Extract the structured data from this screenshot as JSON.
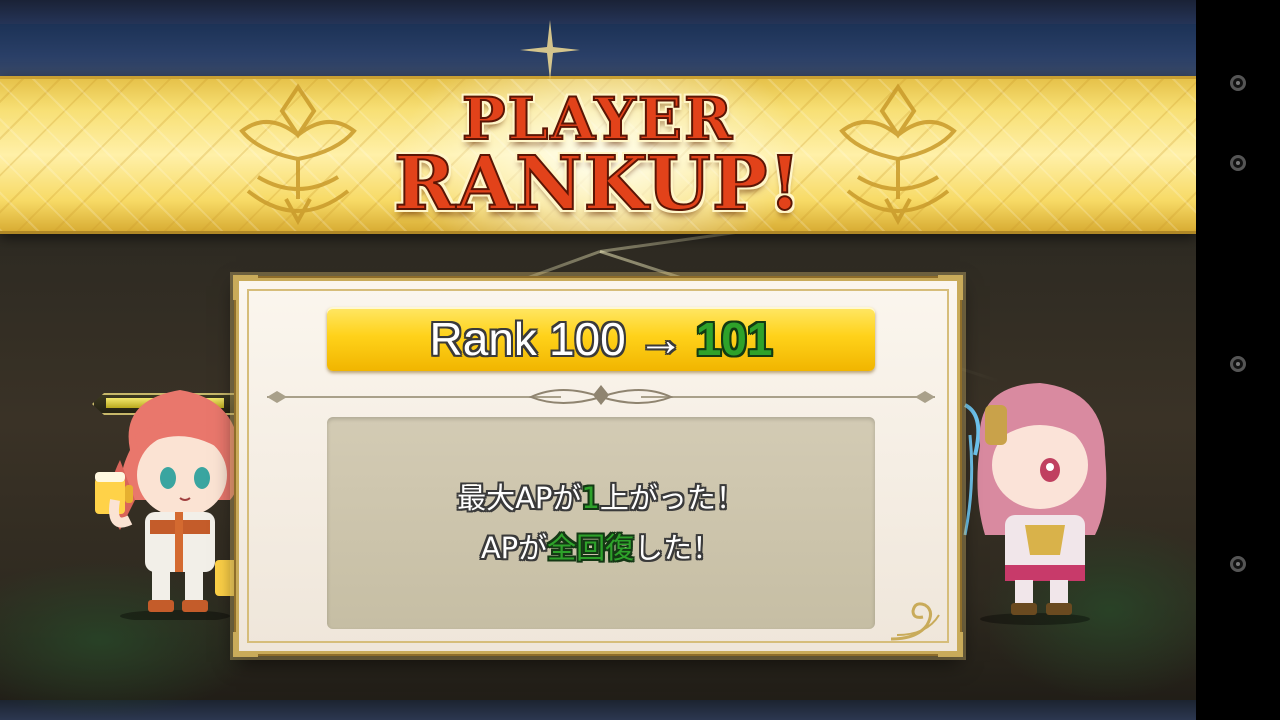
{
  "banner": {
    "title_line1": "PLAYER",
    "title_line2": "RANKUP!"
  },
  "rank": {
    "label": "Rank",
    "old": "100",
    "arrow": "→",
    "new": "101"
  },
  "message": {
    "line1": {
      "part1": "最大APが",
      "highlight": "1",
      "part2": "上がった！"
    },
    "line2": {
      "part1": "APが",
      "highlight": "全回復",
      "part2": "した！"
    }
  },
  "player_hp": {
    "fill_fraction": 0.95
  },
  "colors": {
    "title_red": "#e2421a",
    "rank_bar_gold": "#ffd21a",
    "highlight_green": "#2ea22a",
    "banner_gold": "#f7df74"
  },
  "icons": [
    "crest-icon",
    "ornament-divider-icon",
    "flourish-icon"
  ],
  "nav": [
    "nav-button",
    "nav-button",
    "nav-button",
    "nav-button"
  ]
}
